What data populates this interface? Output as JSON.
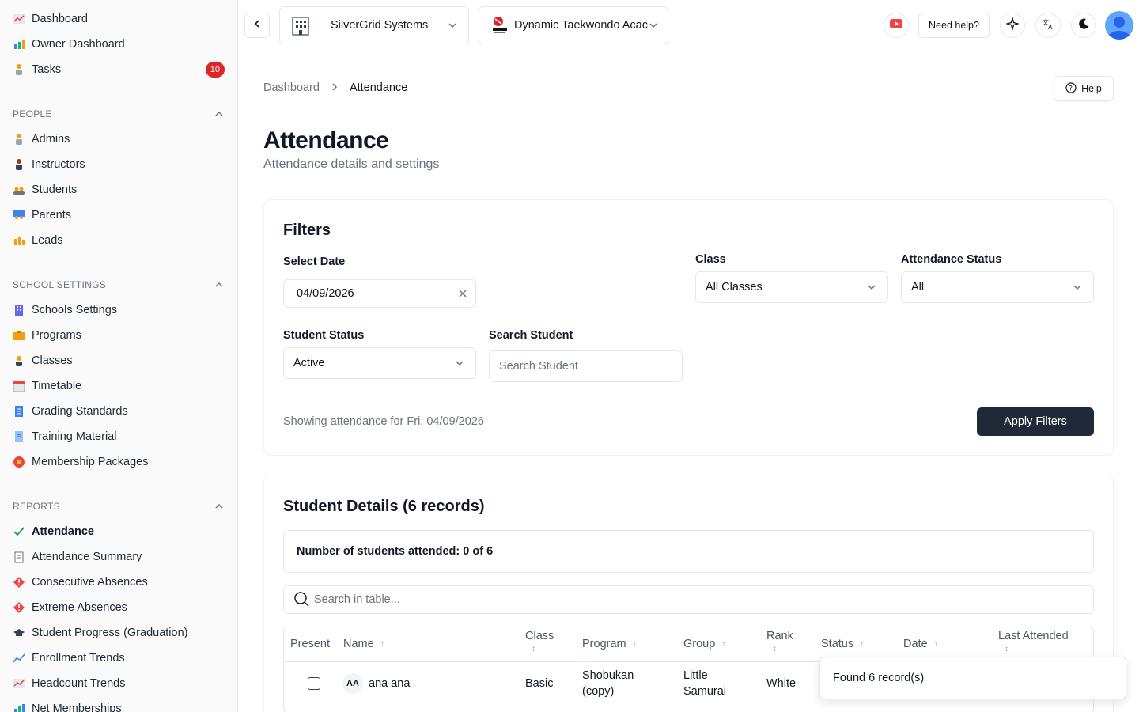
{
  "sidebar": {
    "top_items": [
      {
        "label": "Dashboard",
        "icon": "chart-icon"
      },
      {
        "label": "Owner Dashboard",
        "icon": "bar-chart-icon"
      },
      {
        "label": "Tasks",
        "icon": "person-icon",
        "badge": "10"
      }
    ],
    "sections": [
      {
        "title": "PEOPLE",
        "items": [
          "Admins",
          "Instructors",
          "Students",
          "Parents",
          "Leads"
        ]
      },
      {
        "title": "SCHOOL SETTINGS",
        "items": [
          "Schools Settings",
          "Programs",
          "Classes",
          "Timetable",
          "Grading Standards",
          "Training Material",
          "Membership Packages"
        ]
      },
      {
        "title": "REPORTS",
        "items": [
          "Attendance",
          "Attendance Summary",
          "Consecutive Absences",
          "Extreme Absences",
          "Student Progress (Graduation)",
          "Enrollment Trends",
          "Headcount Trends",
          "Net Memberships"
        ]
      }
    ]
  },
  "topbar": {
    "organization": "SilverGrid Systems",
    "school": "Dynamic Taekwondo Acac",
    "need_help": "Need help?"
  },
  "breadcrumb": {
    "root": "Dashboard",
    "current": "Attendance"
  },
  "help_button": "Help",
  "page": {
    "title": "Attendance",
    "subtitle": "Attendance details and settings"
  },
  "filters": {
    "title": "Filters",
    "date_label": "Select Date",
    "date_value": "04/09/2026",
    "class_label": "Class",
    "class_value": "All Classes",
    "att_status_label": "Attendance Status",
    "att_status_value": "All",
    "student_status_label": "Student Status",
    "student_status_value": "Active",
    "search_label": "Search Student",
    "search_placeholder": "Search Student",
    "showing_text": "Showing attendance for Fri, 04/09/2026",
    "apply_label": "Apply Filters"
  },
  "details": {
    "title": "Student Details (6 records)",
    "attended_text": "Number of students attended: 0 of 6",
    "table_search_placeholder": "Search in table...",
    "columns": [
      "Present",
      "Name",
      "Class",
      "Program",
      "Group",
      "Rank",
      "Status",
      "Date",
      "Last Attended"
    ],
    "rows": [
      {
        "initials": "AA",
        "name": "ana ana",
        "class": "Basic",
        "program_1": "Shobukan",
        "program_2": "(copy)",
        "group_1": "Little",
        "group_2": "Samurai",
        "rank": "White"
      }
    ]
  },
  "toast": "Found 6 record(s)"
}
